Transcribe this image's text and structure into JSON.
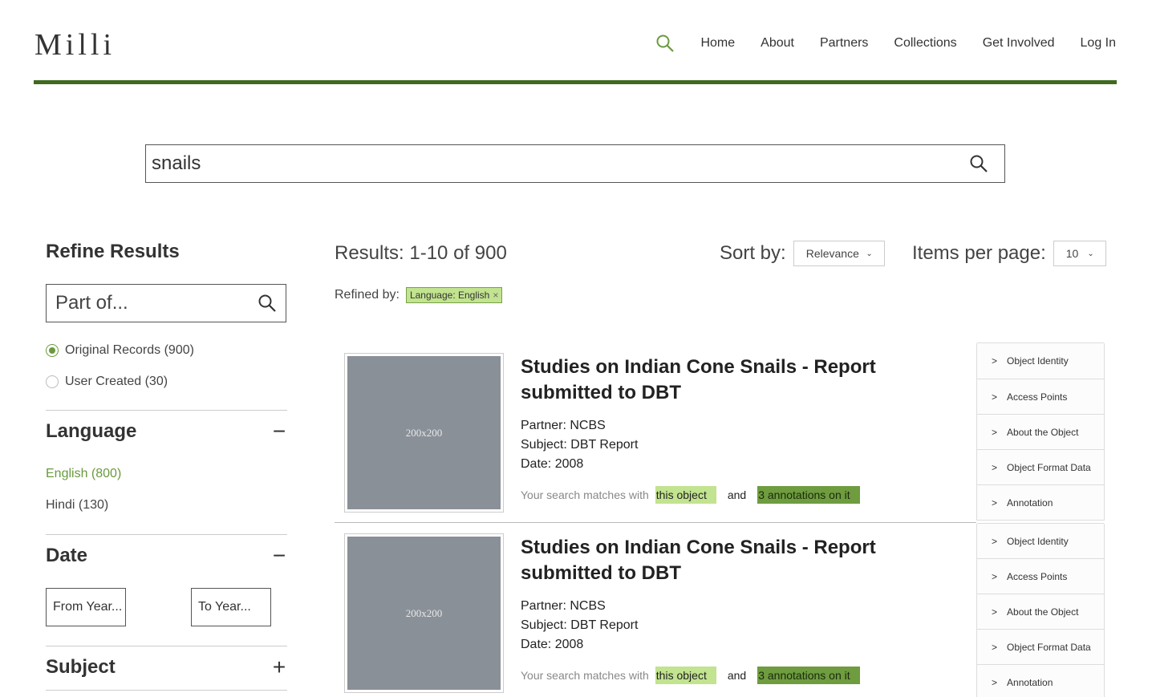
{
  "header": {
    "logo": "Milli",
    "nav": [
      "Home",
      "About",
      "Partners",
      "Collections",
      "Get Involved",
      "Log In"
    ]
  },
  "search": {
    "value": "snails"
  },
  "sidebar": {
    "title": "Refine Results",
    "part_of_placeholder": "Part of...",
    "record_types": [
      {
        "label": "Original Records (900)",
        "selected": true
      },
      {
        "label": "User Created (30)",
        "selected": false
      }
    ],
    "language": {
      "title": "Language",
      "toggle": "−",
      "items": [
        "English (800)",
        "Hindi (130)"
      ]
    },
    "date": {
      "title": "Date",
      "toggle": "−",
      "from_placeholder": "From Year...",
      "to_placeholder": "To Year..."
    },
    "subject": {
      "title": "Subject",
      "toggle": "+"
    }
  },
  "results": {
    "summary": "Results: 1-10 of 900",
    "sort_label": "Sort by:",
    "sort_value": "Relevance",
    "per_page_label": "Items per page:",
    "per_page_value": "10",
    "refined_label": "Refined by:",
    "refined_chip": "Language: English",
    "chip_close": "×",
    "items": [
      {
        "thumb": "200x200",
        "title": "Studies on Indian Cone Snails - Report submitted to DBT",
        "partner": "Partner: NCBS",
        "subject": "Subject: DBT Report",
        "date": "Date: 2008",
        "match_prefix": "Your search matches with",
        "match_object": "this object",
        "match_and": "and",
        "match_annotations": "3 annotations on it"
      },
      {
        "thumb": "200x200",
        "title": "Studies on Indian Cone Snails - Report submitted to DBT",
        "partner": "Partner: NCBS",
        "subject": "Subject: DBT Report",
        "date": "Date: 2008",
        "match_prefix": "Your search matches with",
        "match_object": "this object",
        "match_and": "and",
        "match_annotations": "3 annotations on it"
      }
    ],
    "facet_panel": [
      "Object Identity",
      "Access Points",
      "About the Object",
      "Object Format Data",
      "Annotation"
    ]
  },
  "colors": {
    "accent_green": "#6a9a3e",
    "rule_green": "#3f6a1f",
    "highlight_light": "#c2e38f",
    "highlight_dark": "#6e9c3f"
  }
}
